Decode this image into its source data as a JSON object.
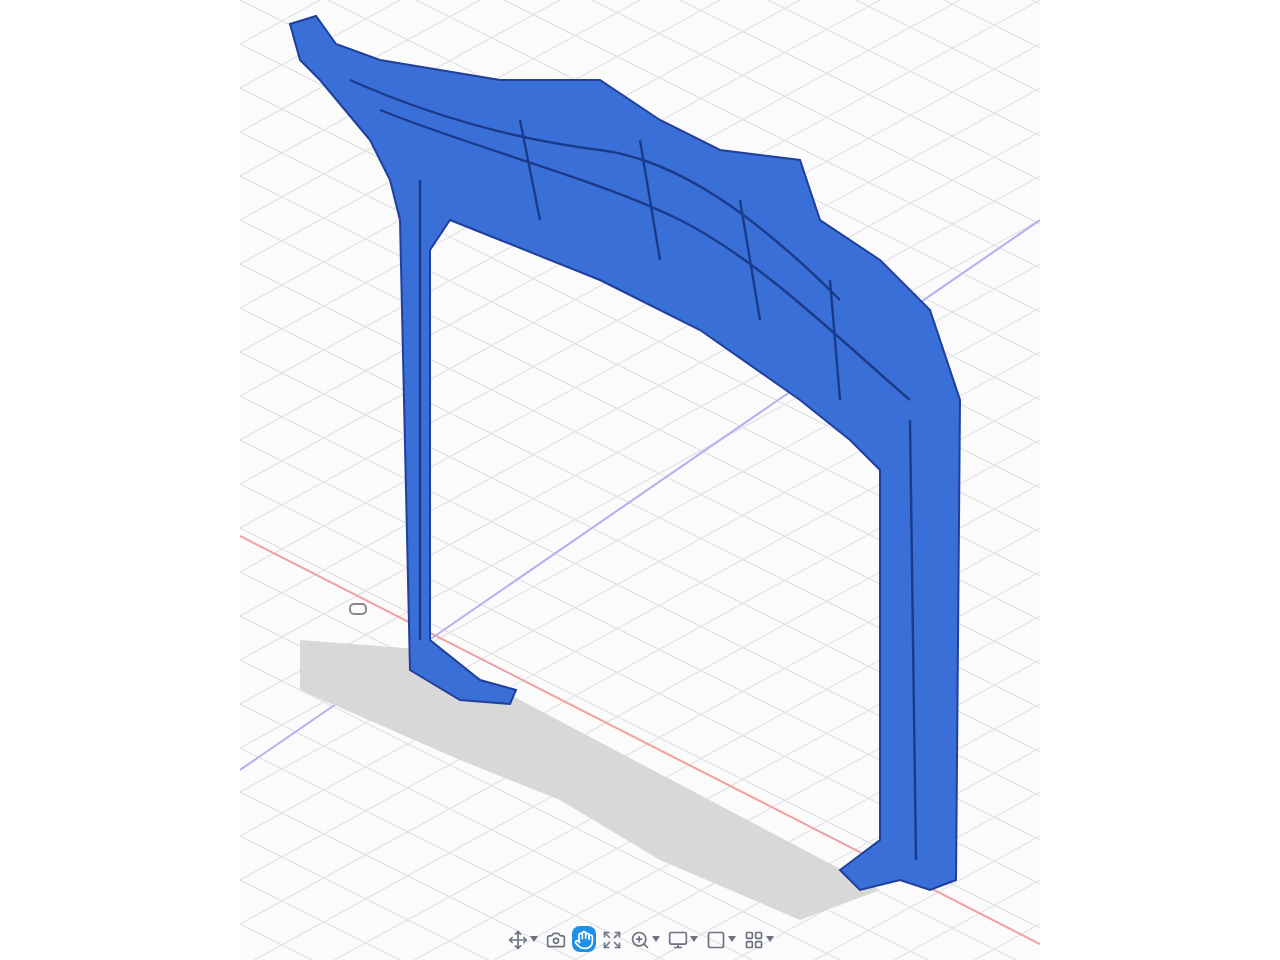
{
  "toolbar": [
    {
      "kind": "orbit",
      "selected": false,
      "dropdown": true
    },
    {
      "kind": "look",
      "selected": false,
      "dropdown": false
    },
    {
      "kind": "pan",
      "selected": true,
      "dropdown": false
    },
    {
      "kind": "fit",
      "selected": false,
      "dropdown": false
    },
    {
      "kind": "zoom",
      "selected": false,
      "dropdown": true
    },
    {
      "kind": "display",
      "selected": false,
      "dropdown": true
    },
    {
      "kind": "visual",
      "selected": false,
      "dropdown": true
    },
    {
      "kind": "grid",
      "selected": false,
      "dropdown": true
    }
  ]
}
